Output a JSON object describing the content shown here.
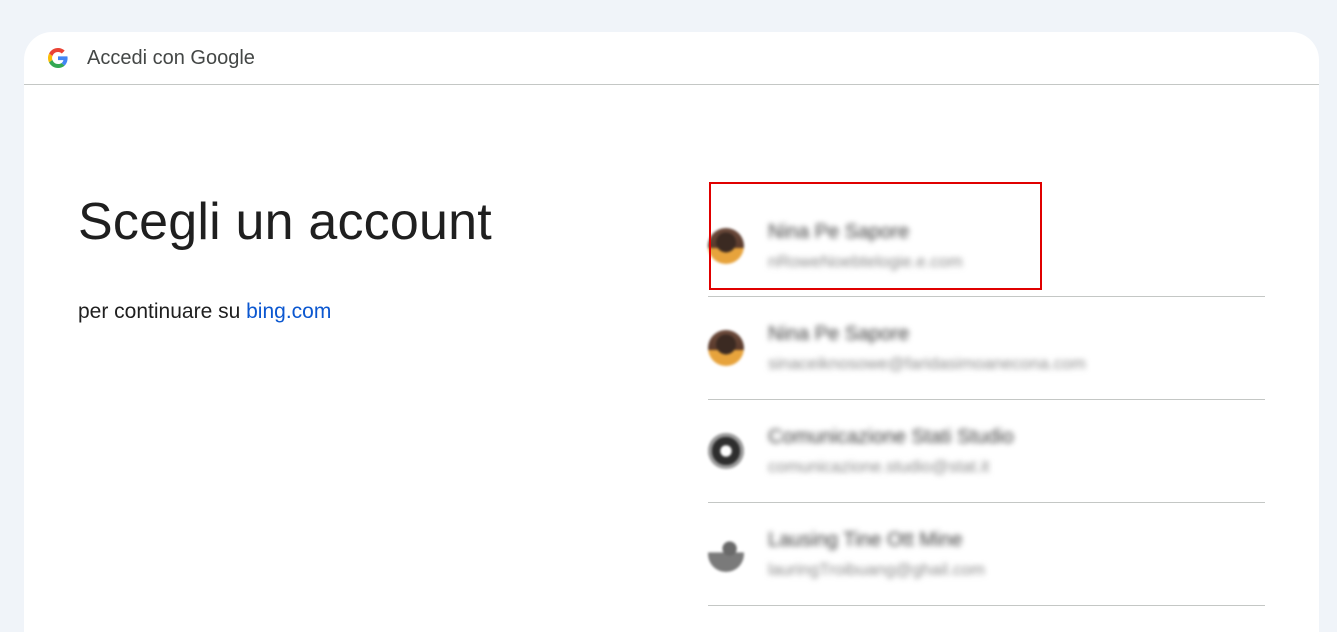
{
  "header": {
    "logo_icon": "google-g-icon",
    "title": "Accedi con Google"
  },
  "main": {
    "title": "Scegli un account",
    "subtitle_prefix": "per continuare su ",
    "subtitle_link": "bing.com"
  },
  "accounts": [
    {
      "name": "Nina Pe Sapore",
      "email": "nRoweNoebtelogie.e.com",
      "avatar": "photo-avatar"
    },
    {
      "name": "Nina Pe Sapore",
      "email": "sinaceiknosowe@faridasimoanecona.com",
      "avatar": "photo-avatar"
    },
    {
      "name": "Comunicazione Stati Studio",
      "email": "comunicazione.studio@stat.it",
      "avatar": "gear-avatar"
    },
    {
      "name": "Lausing Tine Ott Mine",
      "email": "lauringTroibuang@ghail.com",
      "avatar": "figure-avatar"
    }
  ],
  "colors": {
    "background": "#f0f4f9",
    "link": "#0b57d0",
    "highlight": "#e00000",
    "divider": "#c4c7c5"
  }
}
